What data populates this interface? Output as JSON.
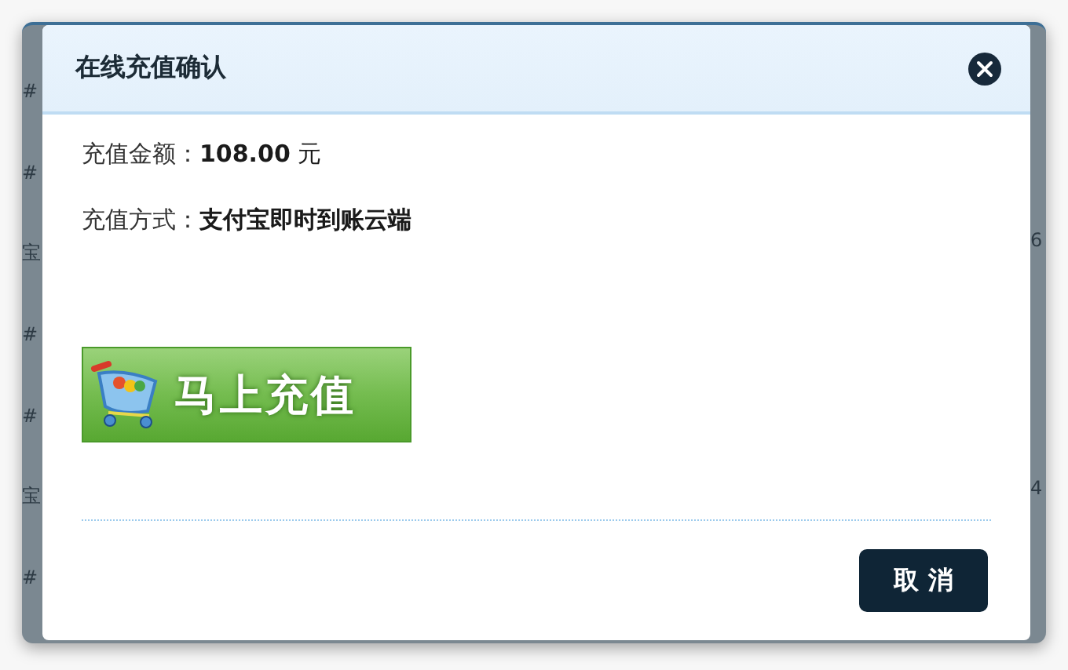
{
  "backdrop": {
    "left_fragments": [
      "#",
      "#",
      "宝",
      "#",
      "#",
      "宝",
      "#"
    ],
    "right_fragments": [
      "6",
      "4"
    ]
  },
  "dialog": {
    "title": "在线充值确认",
    "fields": [
      {
        "kind": "amount",
        "label": "充值金额：",
        "value": "**108.00** 元"
      },
      {
        "kind": "method",
        "label": "充值方式：",
        "value": "支付宝即时到账云端"
      }
    ],
    "pay_button": "马上充值",
    "cancel_button": "取 消"
  }
}
